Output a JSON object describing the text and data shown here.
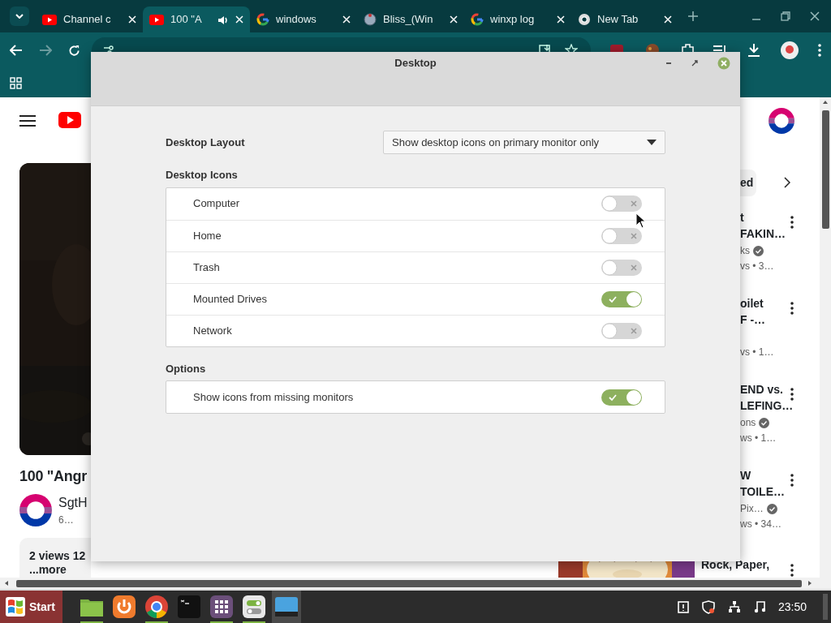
{
  "browser": {
    "tabs": [
      {
        "title": "Channel c",
        "kind": "youtube",
        "selected": false,
        "audio": false
      },
      {
        "title": "100 \"A",
        "kind": "youtube",
        "selected": true,
        "audio": true
      },
      {
        "title": "windows",
        "kind": "google",
        "selected": false,
        "audio": false
      },
      {
        "title": "Bliss_(Win",
        "kind": "wiki",
        "selected": false,
        "audio": false
      },
      {
        "title": "winxp log",
        "kind": "google",
        "selected": false,
        "audio": false
      },
      {
        "title": "New Tab",
        "kind": "chrome",
        "selected": false,
        "audio": false
      }
    ]
  },
  "page": {
    "video_title": "100 \"Angr",
    "channel": "SgtH",
    "channel_meta": "6…",
    "description": "2 views  12",
    "more": "...more",
    "chip": "ed",
    "recommendations": [
      {
        "kind": "covered",
        "title": [
          "t",
          "FAKIN…"
        ],
        "channel": "ks",
        "verified": true,
        "meta": "vs • 3…"
      },
      {
        "kind": "covered",
        "title": [
          "oilet",
          "F -…"
        ],
        "meta": "vs • 1…"
      },
      {
        "kind": "covered",
        "title": [
          "END vs.",
          "LEFING…"
        ],
        "channel": "ons",
        "verified": true,
        "meta": "ws • 1…"
      },
      {
        "kind": "covered",
        "title": [
          "W",
          "TOILE…"
        ],
        "channel": "Pix…",
        "verified": true,
        "meta": "ws • 34…"
      },
      {
        "kind": "thumbnail",
        "title": [
          "Rock, Paper,"
        ]
      }
    ]
  },
  "dialog": {
    "title": "Desktop",
    "layout": {
      "label": "Desktop Layout",
      "value": "Show desktop icons on primary monitor only"
    },
    "sections": [
      {
        "heading": "Desktop Icons",
        "rows": [
          {
            "label": "Computer",
            "on": false
          },
          {
            "label": "Home",
            "on": false
          },
          {
            "label": "Trash",
            "on": false
          },
          {
            "label": "Mounted Drives",
            "on": true
          },
          {
            "label": "Network",
            "on": false
          }
        ]
      },
      {
        "heading": "Options",
        "rows": [
          {
            "label": "Show icons from missing monitors",
            "on": true
          }
        ]
      }
    ]
  },
  "taskbar": {
    "start": "Start",
    "apps": [
      {
        "kind": "folder",
        "selected": false,
        "running": true
      },
      {
        "kind": "updater",
        "selected": false,
        "running": false
      },
      {
        "kind": "chrome",
        "selected": false,
        "running": true
      },
      {
        "kind": "terminal",
        "selected": false,
        "running": false
      },
      {
        "kind": "grid",
        "selected": false,
        "running": true
      },
      {
        "kind": "toggles",
        "selected": false,
        "running": true
      },
      {
        "kind": "desktop",
        "selected": true,
        "running": false
      }
    ],
    "clock": "23:50"
  }
}
